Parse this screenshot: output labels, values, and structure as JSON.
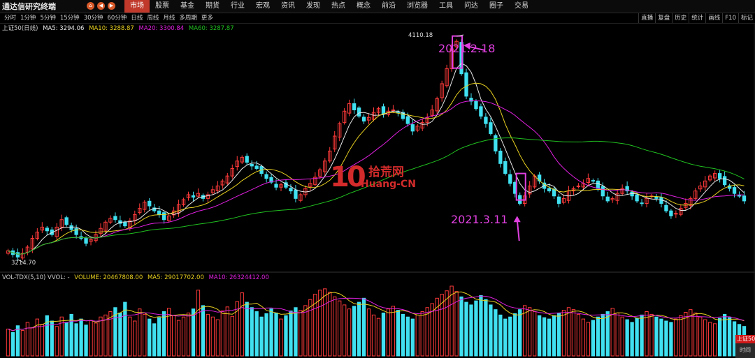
{
  "app": {
    "title": "通达信研究终端"
  },
  "nav_buttons": [
    "home",
    "back",
    "forward",
    "refresh"
  ],
  "menu": [
    {
      "label": "市场",
      "active": true
    },
    {
      "label": "股票"
    },
    {
      "label": "基金"
    },
    {
      "label": "期货"
    },
    {
      "label": "行业"
    },
    {
      "label": "宏观"
    },
    {
      "label": "资讯"
    },
    {
      "label": "发现"
    },
    {
      "label": "热点"
    },
    {
      "label": "概念"
    },
    {
      "label": "前沿"
    },
    {
      "label": "浏览器"
    },
    {
      "label": "工具"
    },
    {
      "label": "问达"
    },
    {
      "label": "圈子"
    },
    {
      "label": "交易"
    }
  ],
  "periods": [
    "分时",
    "1分钟",
    "5分钟",
    "15分钟",
    "30分钟",
    "60分钟",
    "日线",
    "周线",
    "月线",
    "多周期",
    "更多"
  ],
  "right_buttons": [
    "直播",
    "复盘",
    "历史",
    "统计",
    "画线",
    "F10",
    "标记"
  ],
  "ma_legend": {
    "title": "上证50(日线)",
    "ma5": "MA5: 3294.06",
    "ma10": "MA10: 3288.87",
    "ma20": "MA20: 3300.84",
    "ma60": "MA60: 3287.87"
  },
  "vol_legend": {
    "title": "VOL-TDX(5,10)  VVOL: -",
    "volume": "VOLUME: 20467808.00",
    "ma5": "MA5: 29017702.00",
    "ma10": "MA10: 26324412.00"
  },
  "price_labels": {
    "high": "4110.18",
    "low": "3214.70"
  },
  "annotations": {
    "peak": "2021.2.18",
    "drop": "2021.3.11"
  },
  "watermark": {
    "num": "10",
    "cn": "拾荒网",
    "en": "Huang-CN"
  },
  "corner": {
    "top": "上证50",
    "bottom": "时间"
  },
  "colors": {
    "up": "#ff3a3a",
    "down": "#40e0f0",
    "ma5": "#e8e8e8",
    "ma10": "#e8d020",
    "ma20": "#e020e0",
    "ma60": "#20c020",
    "annotation": "#e040e0",
    "menu_active": "#c0392b"
  },
  "chart_data": {
    "type": "candlestick",
    "price_range": [
      3214.7,
      4110.18
    ],
    "closes": [
      3250,
      3235,
      3225,
      3240,
      3265,
      3300,
      3325,
      3345,
      3330,
      3315,
      3345,
      3375,
      3355,
      3335,
      3315,
      3300,
      3280,
      3295,
      3315,
      3340,
      3365,
      3380,
      3375,
      3360,
      3350,
      3370,
      3395,
      3420,
      3445,
      3430,
      3410,
      3395,
      3375,
      3390,
      3410,
      3435,
      3455,
      3475,
      3465,
      3480,
      3460,
      3475,
      3495,
      3510,
      3530,
      3550,
      3580,
      3610,
      3625,
      3605,
      3590,
      3580,
      3560,
      3540,
      3525,
      3505,
      3515,
      3505,
      3490,
      3460,
      3475,
      3500,
      3520,
      3545,
      3575,
      3610,
      3650,
      3710,
      3760,
      3810,
      3840,
      3815,
      3790,
      3770,
      3785,
      3805,
      3820,
      3800,
      3810,
      3815,
      3805,
      3780,
      3760,
      3730,
      3750,
      3765,
      3785,
      3815,
      3860,
      3920,
      3980,
      4060,
      4090,
      3960,
      3870,
      3850,
      3820,
      3790,
      3760,
      3720,
      3650,
      3600,
      3560,
      3520,
      3480,
      3440,
      3470,
      3510,
      3550,
      3530,
      3500,
      3490,
      3470,
      3440,
      3460,
      3490,
      3500,
      3510,
      3520,
      3540,
      3530,
      3500,
      3470,
      3450,
      3460,
      3480,
      3500,
      3490,
      3470,
      3450,
      3440,
      3460,
      3470,
      3460,
      3440,
      3410,
      3390,
      3400,
      3420,
      3440,
      3460,
      3490,
      3510,
      3530,
      3550,
      3560,
      3540,
      3515,
      3500,
      3480,
      3470,
      3450
    ],
    "volumes": [
      40,
      35,
      45,
      38,
      50,
      42,
      55,
      47,
      60,
      52,
      44,
      58,
      50,
      62,
      48,
      55,
      46,
      53,
      49,
      58,
      61,
      66,
      72,
      64,
      80,
      58,
      52,
      70,
      62,
      55,
      48,
      57,
      66,
      71,
      60,
      53,
      58,
      64,
      70,
      98,
      75,
      62,
      58,
      54,
      67,
      73,
      59,
      81,
      94,
      80,
      72,
      66,
      58,
      63,
      70,
      64,
      55,
      60,
      67,
      72,
      68,
      75,
      84,
      92,
      98,
      100,
      95,
      88,
      82,
      76,
      70,
      74,
      80,
      86,
      70,
      61,
      56,
      64,
      70,
      74,
      68,
      62,
      58,
      55,
      61,
      66,
      72,
      78,
      86,
      92,
      97,
      104,
      96,
      88,
      80,
      76,
      82,
      90,
      84,
      76,
      69,
      61,
      55,
      58,
      63,
      69,
      75,
      72,
      66,
      60,
      57,
      55,
      60,
      64,
      68,
      72,
      69,
      62,
      55,
      50,
      53,
      58,
      62,
      66,
      71,
      64,
      58,
      54,
      50,
      56,
      61,
      66,
      62,
      58,
      55,
      52,
      50,
      55,
      60,
      65,
      69,
      64,
      58,
      54,
      50,
      48,
      56,
      62,
      57,
      51,
      47,
      44
    ]
  }
}
